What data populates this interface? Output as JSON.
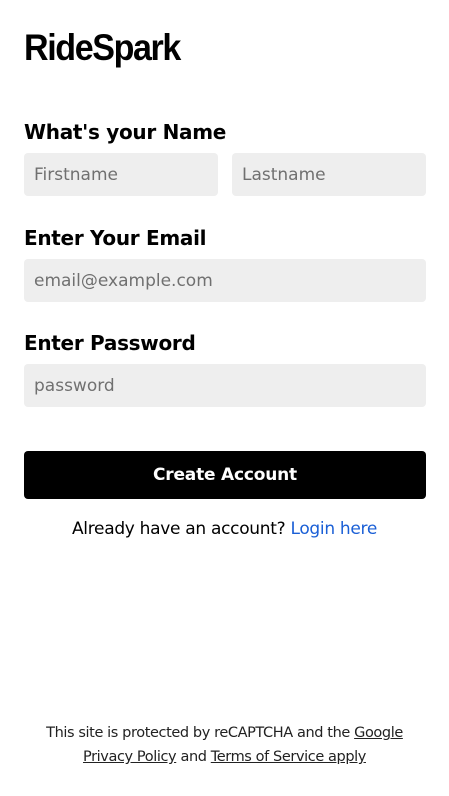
{
  "brand": {
    "name": "RideSpark"
  },
  "form": {
    "name_label": "What's your Name",
    "firstname_placeholder": "Firstname",
    "lastname_placeholder": "Lastname",
    "email_label": "Enter Your Email",
    "email_placeholder": "email@example.com",
    "password_label": "Enter Password",
    "password_placeholder": "password",
    "submit_label": "Create Account"
  },
  "login_prompt": {
    "text": "Already have an account?",
    "link_label": "Login here"
  },
  "footer": {
    "text_before": "This site is protected by reCAPTCHA and the",
    "google_link": "Google",
    "privacy_link": "Privacy Policy",
    "and_text": "and",
    "terms_link": "Terms of Service apply"
  },
  "colors": {
    "input_background": "#eeeeee",
    "button_background": "#000000",
    "link_color": "#1a5fd6"
  }
}
